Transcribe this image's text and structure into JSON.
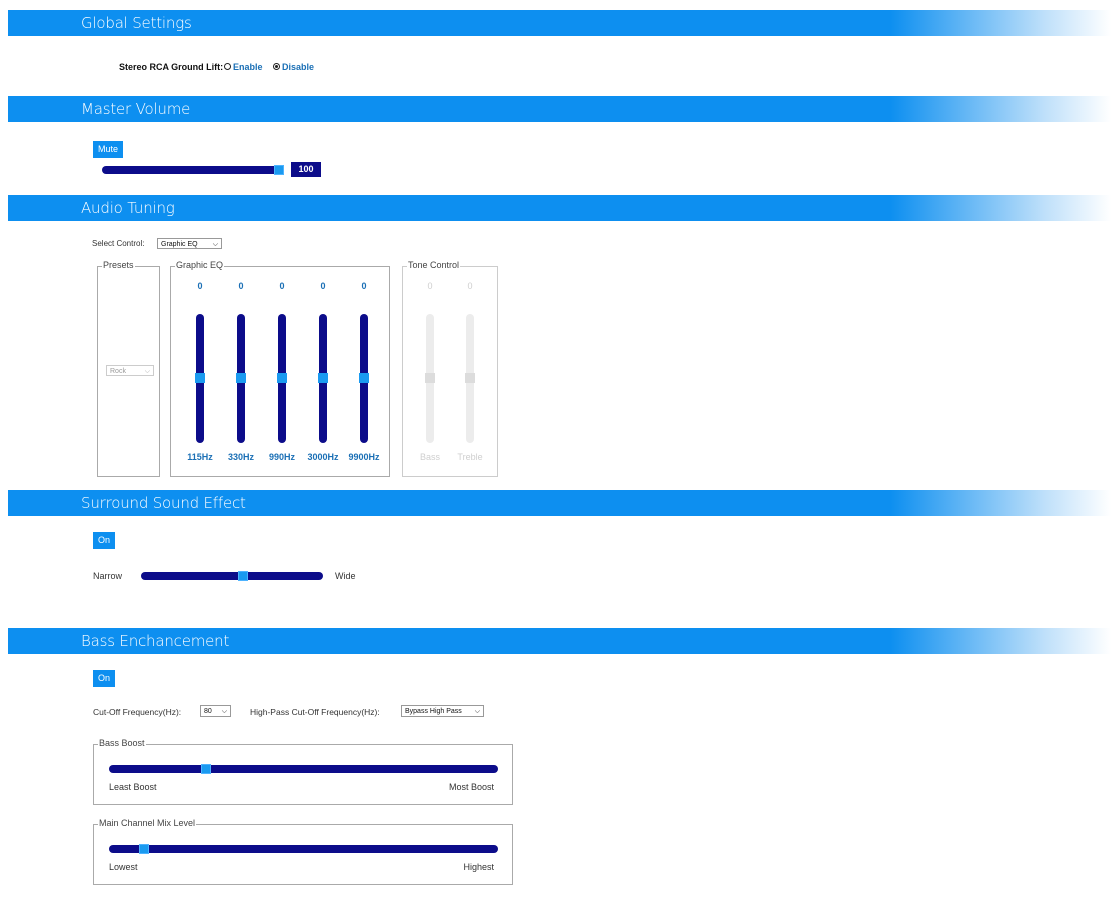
{
  "global": {
    "title": "Global Settings",
    "ground_lift_label": "Stereo RCA Ground Lift:",
    "enable_label": "Enable",
    "disable_label": "Disable",
    "selected": "Disable"
  },
  "master": {
    "title": "Master Volume",
    "mute_label": "Mute",
    "volume_value": "100",
    "volume_fraction": 1.0
  },
  "tuning": {
    "title": "Audio Tuning",
    "select_control_label": "Select Control:",
    "select_control_value": "Graphic EQ",
    "presets_legend": "Presets",
    "preset_value": "Rock",
    "geq_legend": "Graphic EQ",
    "geq_bands": [
      {
        "value": "0",
        "freq": "115Hz"
      },
      {
        "value": "0",
        "freq": "330Hz"
      },
      {
        "value": "0",
        "freq": "990Hz"
      },
      {
        "value": "0",
        "freq": "3000Hz"
      },
      {
        "value": "0",
        "freq": "9900Hz"
      }
    ],
    "tone_legend": "Tone Control",
    "tone_bands": [
      {
        "value": "0",
        "label": "Bass"
      },
      {
        "value": "0",
        "label": "Treble"
      }
    ]
  },
  "surround": {
    "title": "Surround Sound Effect",
    "on_label": "On",
    "narrow_label": "Narrow",
    "wide_label": "Wide",
    "level_fraction": 0.5
  },
  "bass": {
    "title": "Bass Enchancement",
    "on_label": "On",
    "cutoff_label": "Cut-Off Frequency(Hz):",
    "cutoff_value": "80",
    "highpass_label": "High-Pass Cut-Off Frequency(Hz):",
    "highpass_value": "Bypass High Pass",
    "boost_legend": "Bass Boost",
    "least_boost_label": "Least Boost",
    "most_boost_label": "Most Boost",
    "boost_fraction": 0.25,
    "mix_legend": "Main Channel Mix Level",
    "lowest_label": "Lowest",
    "highest_label": "Highest",
    "mix_fraction": 0.09
  },
  "colors": {
    "accent": "#0d8ff0",
    "track": "#0c0c8a",
    "thumb": "#1a9af0",
    "value_text": "#1a6fb5"
  }
}
